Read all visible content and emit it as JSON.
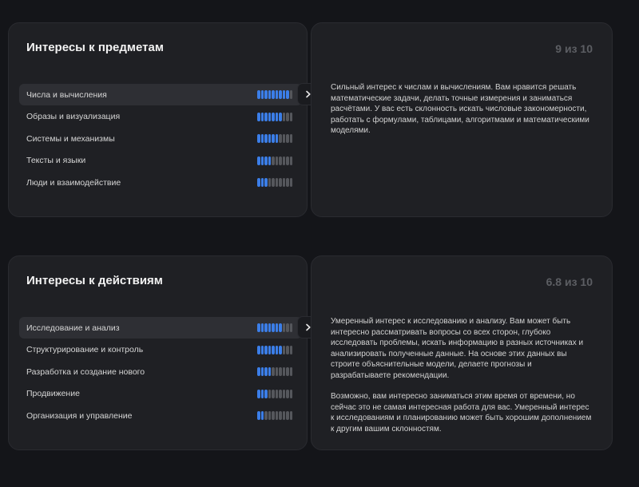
{
  "sections": [
    {
      "title": "Интересы к предметам",
      "score": "9 из 10",
      "rows": [
        {
          "label": "Числа и вычисления",
          "level": 9,
          "active": true
        },
        {
          "label": "Образы и визуализация",
          "level": 7,
          "active": false
        },
        {
          "label": "Системы и механизмы",
          "level": 6,
          "active": false
        },
        {
          "label": "Тексты и языки",
          "level": 4,
          "active": false
        },
        {
          "label": "Люди и взаимодействие",
          "level": 3,
          "active": false
        }
      ],
      "description": [
        "Сильный интерес к числам и вычислениям. Вам нравится решать математические задачи, делать точные измерения и заниматься расчётами. У вас есть склонность искать числовые закономерности, работать с формулами, таблицами, алгоритмами и математическими моделями."
      ]
    },
    {
      "title": "Интересы к действиям",
      "score": "6.8 из 10",
      "rows": [
        {
          "label": "Исследование и анализ",
          "level": 7,
          "active": true
        },
        {
          "label": "Структурирование и контроль",
          "level": 7,
          "active": false
        },
        {
          "label": "Разработка и создание нового",
          "level": 4,
          "active": false
        },
        {
          "label": "Продвижение",
          "level": 3,
          "active": false
        },
        {
          "label": "Организация и управление",
          "level": 2,
          "active": false
        }
      ],
      "description": [
        "Умеренный интерес к исследованию и анализу. Вам может быть интересно рассматривать вопросы со всех сторон, глубоко исследовать проблемы, искать информацию в разных источниках и анализировать полученные данные. На основе этих данных вы строите объяснительные модели, делаете прогнозы и разрабатываете рекомендации.",
        "Возможно, вам интересно заниматься этим время от времени, но сейчас это не самая интересная работа для вас. Умеренный интерес к исследованиям и планированию может быть хорошим дополнением к другим вашим склонностям."
      ]
    }
  ],
  "bar_total": 10,
  "colors": {
    "bar_on": "#3b7ee8",
    "bar_off": "#55575c",
    "card_bg": "#1f2024",
    "page_bg": "#141519"
  },
  "icons": {
    "next": "chevron-right-icon"
  }
}
